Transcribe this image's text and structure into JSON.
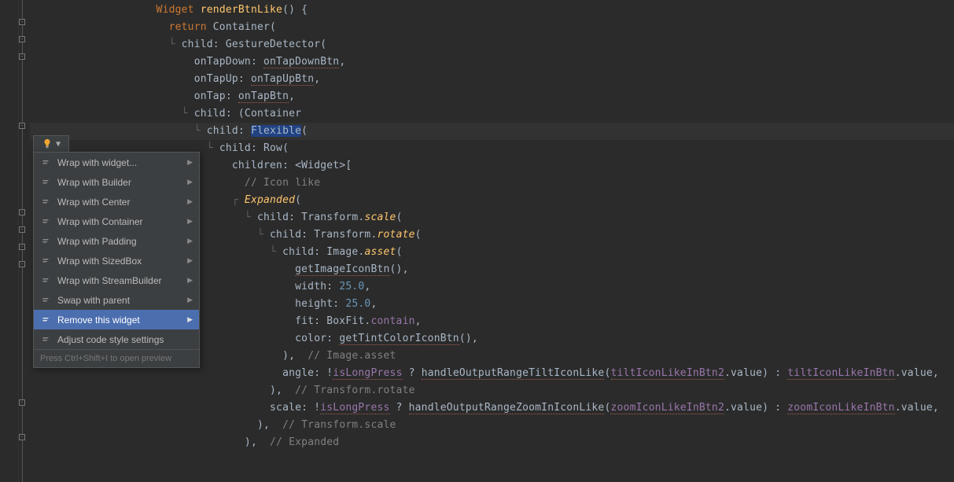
{
  "code": {
    "l1_a": "Widget ",
    "l1_b": "renderBtnLike",
    "l1_c": "() {",
    "l2_a": "return ",
    "l2_b": "Container",
    "l2_c": "(",
    "l3_a": "child: ",
    "l3_b": "GestureDetector",
    "l3_c": "(",
    "l4_a": "onTapDown: ",
    "l4_b": "onTapDownBtn",
    "l4_c": ",",
    "l5_a": "onTapUp: ",
    "l5_b": "onTapUpBtn",
    "l5_c": ",",
    "l6_a": "onTap: ",
    "l6_b": "onTapBtn",
    "l6_c": ",",
    "l7_a": "child: ",
    "l7_b": "Container",
    "l7_c": "(",
    "l8_a": "child: ",
    "l8_b": "Flexible",
    "l8_c": "(",
    "l9_a": "child: ",
    "l9_b": "Row",
    "l9_c": "(",
    "l10_a": "children: <",
    "l10_b": "Widget",
    "l10_c": ">[",
    "l11": "// Icon like",
    "l12_a": "Expanded",
    "l12_b": "(",
    "l13_a": "child: ",
    "l13_b": "Transform",
    "l13_c": ".",
    "l13_d": "scale",
    "l13_e": "(",
    "l14_a": "child: ",
    "l14_b": "Transform",
    "l14_c": ".",
    "l14_d": "rotate",
    "l14_e": "(",
    "l15_a": "child: ",
    "l15_b": "Image",
    "l15_c": ".",
    "l15_d": "asset",
    "l15_e": "(",
    "l16_a": "getImageIconBtn",
    "l16_b": "(),",
    "l17_a": "width: ",
    "l17_b": "25.0",
    "l17_c": ",",
    "l18_a": "height: ",
    "l18_b": "25.0",
    "l18_c": ",",
    "l19_a": "fit: BoxFit.",
    "l19_b": "contain",
    "l19_c": ",",
    "l20_a": "color: ",
    "l20_b": "getTintColorIconBtn",
    "l20_c": "(),",
    "l21_a": "),  ",
    "l21_b": "// Image.asset",
    "l22_a": "angle: !",
    "l22_b": "isLongPress",
    "l22_c": " ? ",
    "l22_d": "handleOutputRangeTiltIconLike",
    "l22_e": "(",
    "l22_f": "tiltIconLikeInBtn2",
    "l22_g": ".value) : ",
    "l22_h": "tiltIconLikeInBtn",
    "l22_i": ".value,",
    "l23_a": "),  ",
    "l23_b": "// Transform.rotate",
    "l24_a": "scale: !",
    "l24_b": "isLongPress",
    "l24_c": " ? ",
    "l24_d": "handleOutputRangeZoomInIconLike",
    "l24_e": "(",
    "l24_f": "zoomIconLikeInBtn2",
    "l24_g": ".value) : ",
    "l24_h": "zoomIconLikeInBtn",
    "l24_i": ".value,",
    "l25_a": "),  ",
    "l25_b": "// Transform.scale",
    "l26_a": "),  ",
    "l26_b": "// Expanded"
  },
  "menu": {
    "items": [
      "Wrap with widget...",
      "Wrap with Builder",
      "Wrap with Center",
      "Wrap with Container",
      "Wrap with Padding",
      "Wrap with SizedBox",
      "Wrap with StreamBuilder",
      "Swap with parent",
      "Remove this widget",
      "Adjust code style settings"
    ],
    "footer": "Press Ctrl+Shift+I to open preview"
  }
}
